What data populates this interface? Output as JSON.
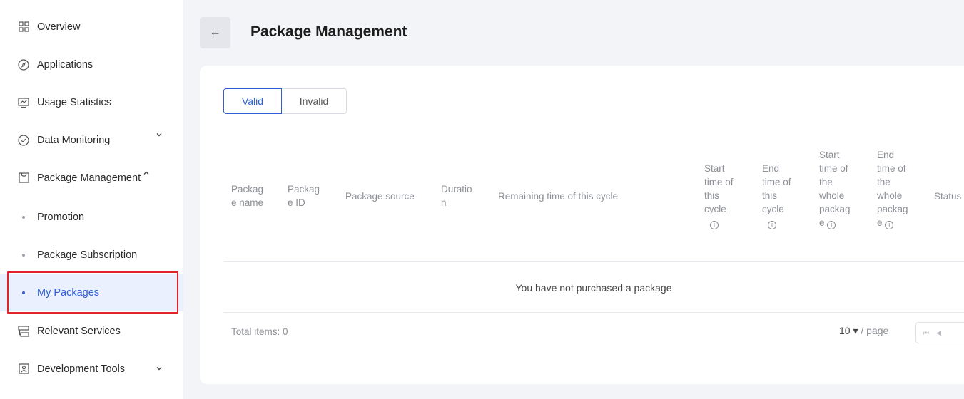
{
  "sidebar": {
    "items": [
      {
        "label": "Overview",
        "icon": "grid-icon"
      },
      {
        "label": "Applications",
        "icon": "compass-icon"
      },
      {
        "label": "Usage Statistics",
        "icon": "chart-icon"
      },
      {
        "label": "Data Monitoring",
        "icon": "gauge-icon"
      },
      {
        "label": "Package Management",
        "icon": "package-icon"
      },
      {
        "label": "Relevant Services",
        "icon": "services-icon"
      },
      {
        "label": "Development Tools",
        "icon": "tools-icon"
      }
    ],
    "sub_items": [
      {
        "label": "Promotion"
      },
      {
        "label": "Package Subscription"
      },
      {
        "label": "My Packages"
      }
    ],
    "chevron_down": "⌄",
    "chevron_up": "^"
  },
  "header": {
    "back_icon": "←",
    "title": "Package Management"
  },
  "tabs": {
    "valid": "Valid",
    "invalid": "Invalid"
  },
  "table": {
    "columns": [
      {
        "lines": [
          "Packag",
          "e name"
        ]
      },
      {
        "lines": [
          "Packag",
          "e ID"
        ]
      },
      {
        "lines": [
          "Package source"
        ]
      },
      {
        "lines": [
          "Duratio",
          "n"
        ]
      },
      {
        "lines": [
          "Remaining time of this cycle"
        ]
      },
      {
        "lines": [
          "Start",
          "time of",
          "this",
          "cycle"
        ]
      },
      {
        "lines": [
          "End",
          "time of",
          "this",
          "cycle"
        ]
      },
      {
        "lines": [
          "Start",
          "time of",
          "the",
          "whole",
          "packag",
          "e"
        ]
      },
      {
        "lines": [
          "End",
          "time of",
          "the",
          "whole",
          "packag",
          "e"
        ]
      },
      {
        "lines": [
          "Status"
        ]
      }
    ],
    "info_glyph": "i",
    "empty_text": "You have not purchased a package"
  },
  "footer": {
    "total_items": "Total items: 0",
    "page_size": "10",
    "page_size_caret": "▾",
    "per_page": "/ page",
    "first_page_glyph": "⏮",
    "prev_page_glyph": "◀"
  },
  "colors": {
    "accent": "#2d5ed8",
    "highlight_box": "#e0242a",
    "active_bg": "#eaf0fd"
  }
}
